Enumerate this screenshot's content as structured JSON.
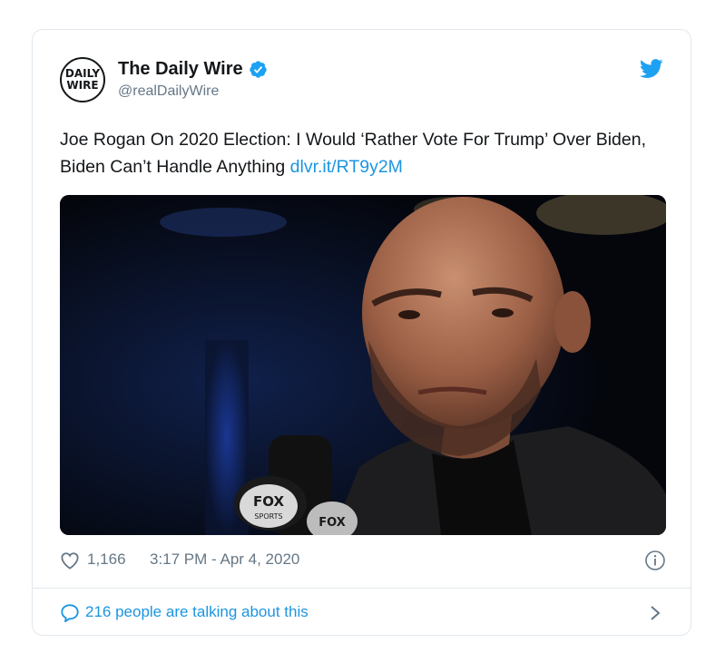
{
  "author": {
    "avatar_line1": "DAILY",
    "avatar_line2": "WIRE",
    "name": "The Daily Wire",
    "handle": "@realDailyWire",
    "verified": true
  },
  "tweet": {
    "text": "Joe Rogan On 2020 Election: I Would ‘Rather Vote For Trump’ Over Biden, Biden Can’t Handle Anything ",
    "link": "dlvr.it/RT9y2M",
    "image_text": {
      "mic_flag_1_line1": "FOX",
      "mic_flag_1_line2": "SPORTS",
      "mic_flag_2": "FOX"
    }
  },
  "meta": {
    "likes": "1,166",
    "timestamp": "3:17 PM - Apr 4, 2020"
  },
  "footer": {
    "talking": "216 people are talking about this"
  },
  "icons": [
    "verified-badge-icon",
    "twitter-bird-icon",
    "heart-icon",
    "info-icon",
    "speech-bubble-icon",
    "chevron-right-icon"
  ],
  "colors": {
    "accent": "#1b95e0",
    "muted": "#657786",
    "text": "#14171a",
    "border": "#e1e8ed"
  }
}
